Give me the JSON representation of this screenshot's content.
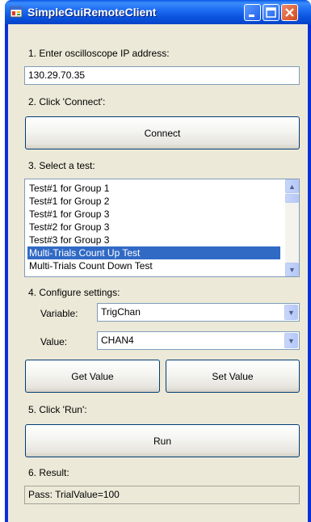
{
  "window": {
    "title": "SimpleGuiRemoteClient"
  },
  "step1": {
    "label": "1. Enter oscilloscope IP address:",
    "ip_value": "130.29.70.35"
  },
  "step2": {
    "label": "2. Click 'Connect':",
    "connect_label": "Connect"
  },
  "step3": {
    "label": "3. Select a test:",
    "tests": [
      "Test#1 for Group 1",
      "Test#1 for Group 2",
      "Test#1 for Group 3",
      "Test#2 for Group 3",
      "Test#3 for Group 3",
      "Multi-Trials Count Up Test",
      "Multi-Trials Count Down Test"
    ],
    "selected_test": "Multi-Trials Count Up Test"
  },
  "step4": {
    "label": "4. Configure settings:",
    "variable_label": "Variable:",
    "variable_value": "TrigChan",
    "value_label": "Value:",
    "value_value": "CHAN4",
    "get_value_label": "Get Value",
    "set_value_label": "Set Value"
  },
  "step5": {
    "label": "5. Click 'Run':",
    "run_label": "Run"
  },
  "step6": {
    "label": "6. Result:",
    "result_text": "Pass: TrialValue=100"
  },
  "icons": {
    "scroll_up": "▲",
    "scroll_down": "▼",
    "dropdown": "▼"
  },
  "colors": {
    "titlebar": "#0a54e0",
    "selection": "#316ac5",
    "client_background": "#ece9d8"
  }
}
